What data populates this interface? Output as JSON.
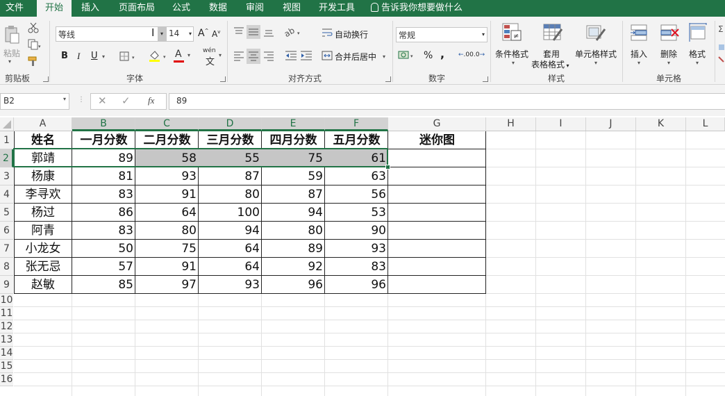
{
  "tabs": [
    "文件",
    "开始",
    "插入",
    "页面布局",
    "公式",
    "数据",
    "审阅",
    "视图",
    "开发工具"
  ],
  "tell_me": "告诉我你想要做什么",
  "ribbon": {
    "paste_label": "粘贴",
    "clipboard_label": "剪贴板",
    "font_name": "等线",
    "font_size": "14",
    "font_group_label": "字体",
    "bold": "B",
    "italic": "I",
    "underline": "U",
    "wrap_text": "自动换行",
    "merge_center": "合并后居中",
    "align_group_label": "对齐方式",
    "number_format": "常规",
    "number_group_label": "数字",
    "cond_format": "条件格式",
    "format_table_1": "套用",
    "format_table_2": "表格格式",
    "cell_styles": "单元格样式",
    "styles_group_label": "样式",
    "insert": "插入",
    "delete": "删除",
    "format": "格式",
    "cells_group_label": "单元格",
    "font_increase": "A",
    "font_decrease": "A",
    "font_color_letter": "A",
    "phonetic": "wén",
    "percent": "%",
    "comma": ",",
    "dec_inc": ".00",
    "dec_dec": ".0"
  },
  "name_box": "B2",
  "formula_value": "89",
  "fx": "fx",
  "columns": [
    "A",
    "B",
    "C",
    "D",
    "E",
    "F",
    "G",
    "H",
    "I",
    "J",
    "K",
    "L"
  ],
  "rows": [
    "1",
    "2",
    "3",
    "4",
    "5",
    "6",
    "7",
    "8",
    "9",
    "10",
    "11",
    "12",
    "13",
    "14",
    "15",
    "16"
  ],
  "table": {
    "headers": [
      "姓名",
      "一月分数",
      "二月分数",
      "三月分数",
      "四月分数",
      "五月分数",
      "迷你图"
    ],
    "rows": [
      {
        "name": "郭靖",
        "vals": [
          "89",
          "58",
          "55",
          "75",
          "61"
        ]
      },
      {
        "name": "杨康",
        "vals": [
          "81",
          "93",
          "87",
          "59",
          "63"
        ]
      },
      {
        "name": "李寻欢",
        "vals": [
          "83",
          "91",
          "80",
          "87",
          "56"
        ]
      },
      {
        "name": "杨过",
        "vals": [
          "86",
          "64",
          "100",
          "94",
          "53"
        ]
      },
      {
        "name": "阿青",
        "vals": [
          "83",
          "80",
          "94",
          "80",
          "90"
        ]
      },
      {
        "name": "小龙女",
        "vals": [
          "50",
          "75",
          "64",
          "89",
          "93"
        ]
      },
      {
        "name": "张无忌",
        "vals": [
          "57",
          "91",
          "64",
          "92",
          "83"
        ]
      },
      {
        "name": "赵敏",
        "vals": [
          "85",
          "97",
          "93",
          "96",
          "96"
        ]
      }
    ]
  },
  "colors": {
    "accent": "#217346",
    "selection": "#c6c6c6",
    "header_bg": "#f3f3f3"
  }
}
